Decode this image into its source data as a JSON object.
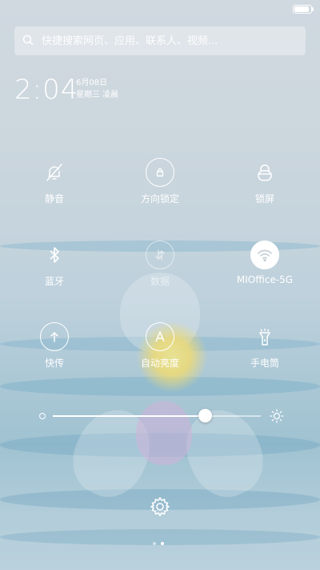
{
  "status_bar": {
    "battery_level": 0.9
  },
  "search": {
    "placeholder": "快捷搜索网页、应用、联系人、视频..."
  },
  "lock": {
    "time": "2:04",
    "date": "6月08日",
    "weekday": "星期三 凌晨"
  },
  "toggles": [
    {
      "id": "mute",
      "label": "静音",
      "icon": "bell-off-icon",
      "state": "off"
    },
    {
      "id": "rotation-lock",
      "label": "方向锁定",
      "icon": "rotation-lock-icon",
      "state": "off"
    },
    {
      "id": "lock-screen",
      "label": "锁屏",
      "icon": "lock-icon",
      "state": "off"
    },
    {
      "id": "bluetooth",
      "label": "蓝牙",
      "icon": "bluetooth-icon",
      "state": "off"
    },
    {
      "id": "data",
      "label": "数据",
      "icon": "data-arrows-icon",
      "state": "disabled"
    },
    {
      "id": "wifi",
      "label": "MIOffice-5G",
      "icon": "wifi-icon",
      "state": "on"
    },
    {
      "id": "share",
      "label": "快传",
      "icon": "upload-icon",
      "state": "off"
    },
    {
      "id": "auto-brightness",
      "label": "自动亮度",
      "icon": "auto-brightness-icon",
      "state": "off"
    },
    {
      "id": "flashlight",
      "label": "手电筒",
      "icon": "flashlight-icon",
      "state": "off"
    }
  ],
  "brightness": {
    "level": 0.73
  },
  "pager": {
    "pages": 2,
    "current": 2
  }
}
